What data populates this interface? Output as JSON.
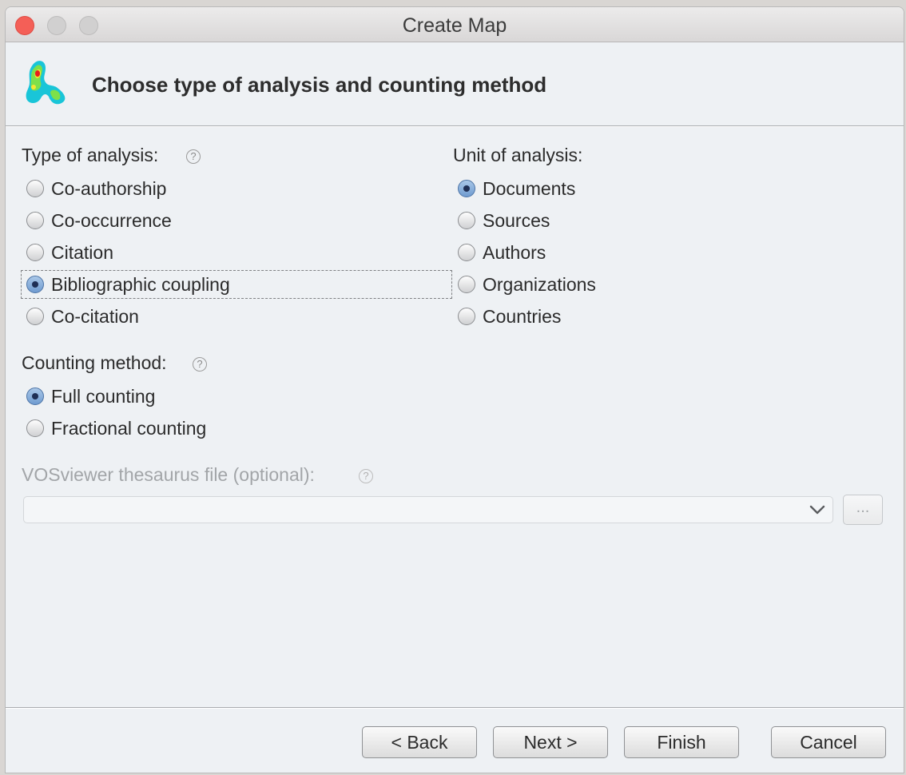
{
  "window": {
    "title": "Create Map"
  },
  "header": {
    "title": "Choose type of analysis and counting method",
    "logo_icon": "vosviewer-density-logo-icon"
  },
  "analysis_type": {
    "label": "Type of analysis:",
    "help_icon": "help-icon",
    "options": [
      {
        "label": "Co-authorship",
        "selected": false
      },
      {
        "label": "Co-occurrence",
        "selected": false
      },
      {
        "label": "Citation",
        "selected": false
      },
      {
        "label": "Bibliographic coupling",
        "selected": true
      },
      {
        "label": "Co-citation",
        "selected": false
      }
    ]
  },
  "unit_of_analysis": {
    "label": "Unit of analysis:",
    "options": [
      {
        "label": "Documents",
        "selected": true
      },
      {
        "label": "Sources",
        "selected": false
      },
      {
        "label": "Authors",
        "selected": false
      },
      {
        "label": "Organizations",
        "selected": false
      },
      {
        "label": "Countries",
        "selected": false
      }
    ]
  },
  "counting_method": {
    "label": "Counting method:",
    "help_icon": "help-icon",
    "options": [
      {
        "label": "Full counting",
        "selected": true
      },
      {
        "label": "Fractional counting",
        "selected": false
      }
    ]
  },
  "thesaurus": {
    "label": "VOSviewer thesaurus file (optional):",
    "value": "",
    "browse_label": "...",
    "help_icon": "help-icon"
  },
  "buttons": {
    "back": "< Back",
    "next": "Next >",
    "finish": "Finish",
    "cancel": "Cancel"
  },
  "colors": {
    "radio_selected": "#6f9bd0",
    "window_bg": "#eef1f4",
    "close_button": "#f45f57"
  }
}
